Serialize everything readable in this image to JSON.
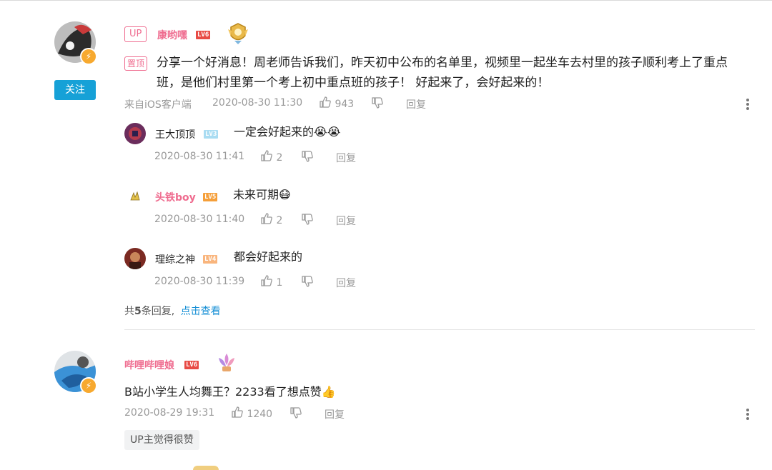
{
  "comments": [
    {
      "username": "康哟嘿",
      "level": "LV6",
      "up_tag": "UP",
      "pin_tag": "置顶",
      "follow_label": "关注",
      "text": "分享一个好消息！周老师告诉我们，昨天初中公布的名单里，视频里一起坐车去村里的孩子顺利考上了重点班，是他们村里第一个考上初中重点班的孩子！ 好起来了，会好起来的！",
      "source": "来自iOS客户端",
      "time": "2020-08-30 11:30",
      "likes": "943",
      "reply_label": "回复",
      "replies": [
        {
          "username": "王大顶顶",
          "level": "LV3",
          "text": "一定会好起来的😭😭",
          "time": "2020-08-30 11:41",
          "likes": "2",
          "reply_label": "回复"
        },
        {
          "username": "头铁boy",
          "level": "LV5",
          "text": "未来可期😷",
          "time": "2020-08-30 11:40",
          "likes": "2",
          "reply_label": "回复"
        },
        {
          "username": "理综之神",
          "level": "LV4",
          "text": "都会好起来的",
          "time": "2020-08-30 11:39",
          "likes": "1",
          "reply_label": "回复"
        }
      ],
      "reply_summary_prefix": "共",
      "reply_summary_count": "5",
      "reply_summary_suffix": "条回复,",
      "reply_summary_link": "点击查看"
    },
    {
      "username": "哔哩哔哩娘",
      "level": "LV6",
      "text": "B站小学生人均舞王？2233看了想点赞👍",
      "time": "2020-08-29 19:31",
      "likes": "1240",
      "reply_label": "回复",
      "up_liked_tag": "UP主觉得很赞"
    }
  ],
  "colors": {
    "accent": "#16a1d7",
    "pink": "#ef6c8f",
    "lv6": "#e84b45"
  },
  "icons": [
    "thumb-up-icon",
    "thumb-down-icon",
    "more-vertical-icon",
    "lightning-badge-icon"
  ]
}
